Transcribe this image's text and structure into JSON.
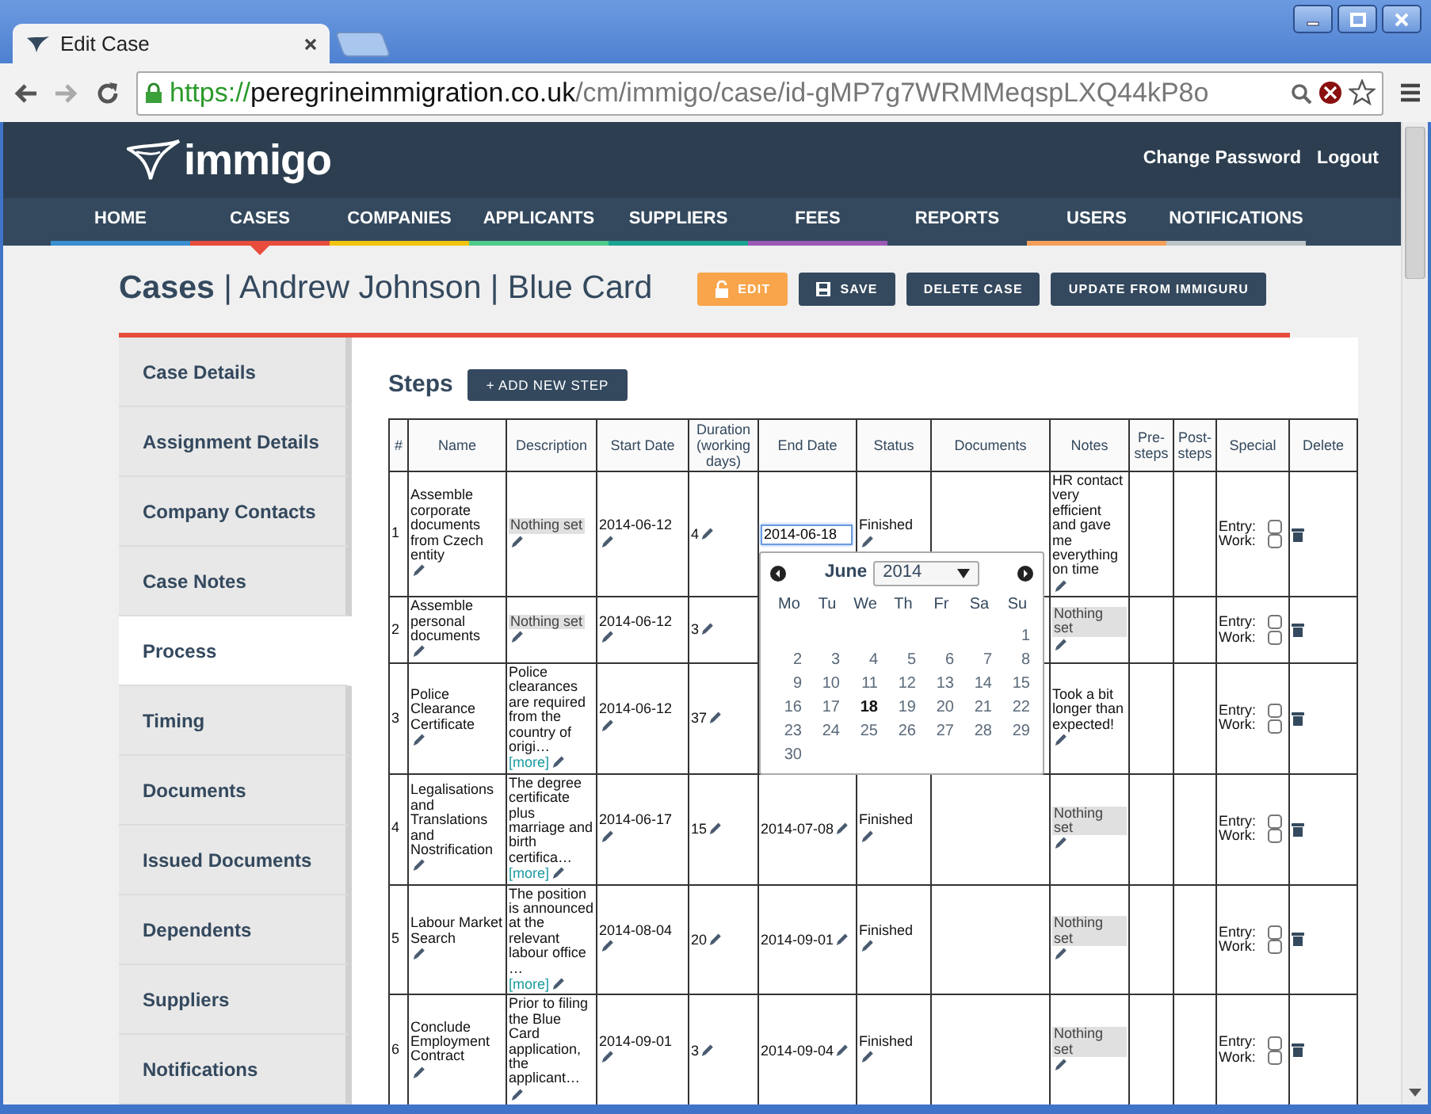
{
  "browser": {
    "tab_title": "Edit Case",
    "url": {
      "scheme": "https://",
      "host": "peregrineimmigration.co.uk",
      "path": "/cm/immigo/case/id-gMP7g7WRMMeqspLXQ44kP8o"
    }
  },
  "header": {
    "logo": "immigo",
    "links": [
      "Change Password",
      "Logout"
    ]
  },
  "nav": [
    {
      "label": "HOME",
      "color": "#3a8fd0",
      "selected": false
    },
    {
      "label": "CASES",
      "color": "#e74c3c",
      "selected": true
    },
    {
      "label": "COMPANIES",
      "color": "#f1c40f",
      "selected": false
    },
    {
      "label": "APPLICANTS",
      "color": "#4ecb8a",
      "selected": false
    },
    {
      "label": "SUPPLIERS",
      "color": "#1aa593",
      "selected": false
    },
    {
      "label": "FEES",
      "color": "#9b59b6",
      "selected": false
    },
    {
      "label": "REPORTS",
      "selected": false
    },
    {
      "label": "USERS",
      "color": "#f5a05a",
      "selected": false
    },
    {
      "label": "NOTIFICATIONS",
      "color": "#bdc3c7",
      "selected": false
    }
  ],
  "page_title": "**Cases** | Andrew Johnson | Blue Card",
  "actions": [
    {
      "label": "EDIT",
      "kind": "edit"
    },
    {
      "label": "SAVE",
      "kind": "save"
    },
    {
      "label": "DELETE CASE",
      "kind": "plain"
    },
    {
      "label": "UPDATE FROM IMMIGURU",
      "kind": "plain"
    }
  ],
  "sidebar": [
    {
      "label": "Case Details",
      "selected": false
    },
    {
      "label": "Assignment Details",
      "selected": false
    },
    {
      "label": "Company Contacts",
      "selected": false
    },
    {
      "label": "Case Notes",
      "selected": false
    },
    {
      "label": "Process",
      "selected": true
    },
    {
      "label": "Timing",
      "selected": false
    },
    {
      "label": "Documents",
      "selected": false
    },
    {
      "label": "Issued Documents",
      "selected": false
    },
    {
      "label": "Dependents",
      "selected": false
    },
    {
      "label": "Suppliers",
      "selected": false
    },
    {
      "label": "Notifications",
      "selected": false
    }
  ],
  "steps": {
    "title": "Steps",
    "add_button": "+ ADD NEW STEP",
    "columns": [
      "#",
      "Name",
      "Description",
      "Start Date",
      "Duration (working days)",
      "End Date",
      "Status",
      "Documents",
      "Notes",
      "Pre-steps",
      "Post-steps",
      "Special",
      "Delete"
    ],
    "rows": [
      {
        "number": "1",
        "name": "Assemble corporate documents from Czech entity",
        "description": {
          "text": "Nothing set",
          "empty": true
        },
        "start": "2014-06-12",
        "duration": "4",
        "end": "2014-06-18",
        "editing": true,
        "status": "Finished",
        "notes": {
          "text": "HR contact very efficient and gave me everything on time",
          "empty": false
        },
        "entry_label": "Entry:",
        "entry": false,
        "work_label": "Work:",
        "work": false
      },
      {
        "number": "2",
        "name": "Assemble personal documents",
        "description": {
          "text": "Nothing set",
          "empty": true
        },
        "start": "2014-06-12",
        "duration": "3",
        "editing": false,
        "notes": {
          "text": "Nothing set",
          "empty": true
        },
        "entry_label": "Entry:",
        "entry": false,
        "work_label": "Work:",
        "work": false
      },
      {
        "number": "3",
        "name": "Police Clearance Certificate",
        "description": {
          "text": "Police clearances are required from the country of origi…",
          "more": "[more]",
          "empty": false
        },
        "start": "2014-06-12",
        "duration": "37",
        "editing": false,
        "notes": {
          "text": "Took a bit longer than expected!",
          "empty": false
        },
        "entry_label": "Entry:",
        "entry": false,
        "work_label": "Work:",
        "work": false
      },
      {
        "number": "4",
        "name": "Legalisations and Translations and Nostrification",
        "description": {
          "text": "The degree certificate plus marriage and birth certifica…",
          "more": "[more]",
          "empty": false
        },
        "start": "2014-06-17",
        "duration": "15",
        "end": "2014-07-08",
        "editing": false,
        "status": "Finished",
        "notes": {
          "text": "Nothing set",
          "empty": true
        },
        "entry_label": "Entry:",
        "entry": false,
        "work_label": "Work:",
        "work": false
      },
      {
        "number": "5",
        "name": "Labour Market Search",
        "description": {
          "text": "The position is announced at the relevant labour office …",
          "more": "[more]",
          "empty": false
        },
        "start": "2014-08-04",
        "duration": "20",
        "end": "2014-09-01",
        "editing": false,
        "status": "Finished",
        "notes": {
          "text": "Nothing set",
          "empty": true
        },
        "entry_label": "Entry:",
        "entry": false,
        "work_label": "Work:",
        "work": false
      },
      {
        "number": "6",
        "name": "Conclude Employment Contract",
        "description": {
          "text": "Prior to filing the Blue Card application, the applicant…",
          "empty": false
        },
        "start": "2014-09-01",
        "duration": "3",
        "end": "2014-09-04",
        "editing": false,
        "status": "Finished",
        "notes": {
          "text": "Nothing set",
          "empty": true
        },
        "entry_label": "Entry:",
        "entry": false,
        "work_label": "Work:",
        "work": false
      }
    ]
  },
  "datepicker": {
    "month": "June",
    "year": "2014",
    "weekdays": [
      "Mo",
      "Tu",
      "We",
      "Th",
      "Fr",
      "Sa",
      "Su"
    ],
    "weeks": [
      {
        "days": [
          {
            "day": "1",
            "selected": false
          }
        ]
      },
      {
        "days": [
          {
            "day": "2",
            "selected": false
          },
          {
            "day": "3",
            "selected": false
          },
          {
            "day": "4",
            "selected": false
          },
          {
            "day": "5",
            "selected": false
          },
          {
            "day": "6",
            "selected": false
          },
          {
            "day": "7",
            "selected": false
          },
          {
            "day": "8",
            "selected": false
          }
        ]
      },
      {
        "days": [
          {
            "day": "9",
            "selected": false
          },
          {
            "day": "10",
            "selected": false
          },
          {
            "day": "11",
            "selected": false
          },
          {
            "day": "12",
            "selected": false
          },
          {
            "day": "13",
            "selected": false
          },
          {
            "day": "14",
            "selected": false
          },
          {
            "day": "15",
            "selected": false
          }
        ]
      },
      {
        "days": [
          {
            "day": "16",
            "selected": false
          },
          {
            "day": "17",
            "selected": false
          },
          {
            "day": "18",
            "selected": true
          },
          {
            "day": "19",
            "selected": false
          },
          {
            "day": "20",
            "selected": false
          },
          {
            "day": "21",
            "selected": false
          },
          {
            "day": "22",
            "selected": false
          }
        ]
      },
      {
        "days": [
          {
            "day": "23",
            "selected": false
          },
          {
            "day": "24",
            "selected": false
          },
          {
            "day": "25",
            "selected": false
          },
          {
            "day": "26",
            "selected": false
          },
          {
            "day": "27",
            "selected": false
          },
          {
            "day": "28",
            "selected": false
          },
          {
            "day": "29",
            "selected": false
          }
        ]
      },
      {
        "days": [
          {
            "day": "30",
            "selected": false
          }
        ]
      }
    ]
  }
}
